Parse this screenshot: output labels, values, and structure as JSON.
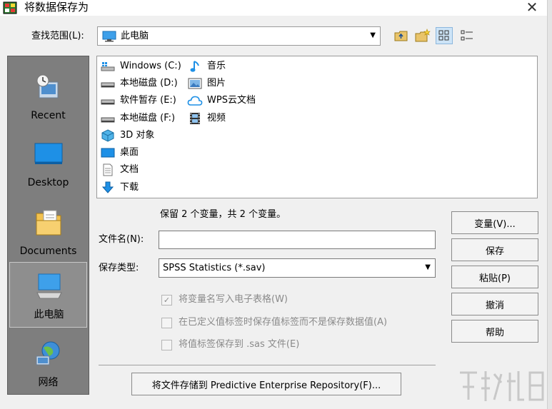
{
  "window": {
    "title": "将数据保存为",
    "close_glyph": "✕"
  },
  "lookin": {
    "label": "查找范围(L):",
    "value": "此电脑"
  },
  "places": [
    {
      "id": "recent",
      "label": "Recent"
    },
    {
      "id": "desktop",
      "label": "Desktop"
    },
    {
      "id": "documents",
      "label": "Documents"
    },
    {
      "id": "thispc",
      "label": "此电脑"
    },
    {
      "id": "network",
      "label": "网络"
    }
  ],
  "files": {
    "drive_c": "Windows (C:)",
    "drive_d": "本地磁盘 (D:)",
    "drive_e": "软件暂存 (E:)",
    "drive_f": "本地磁盘 (F:)",
    "objects3d": "3D 对象",
    "desktop": "桌面",
    "documents": "文档",
    "downloads": "下载",
    "music": "音乐",
    "pictures": "图片",
    "wps": "WPS云文档",
    "videos": "视频"
  },
  "form": {
    "retain_text": "保留 2 个变量，共 2 个变量。",
    "filename_label": "文件名(N):",
    "filename_value": "",
    "savetype_label": "保存类型:",
    "savetype_value": "SPSS Statistics (*.sav)",
    "options": [
      {
        "label": "将变量名写入电子表格(W)",
        "checked": true
      },
      {
        "label": "在已定义值标签时保存值标签而不是保存数据值(A)",
        "checked": false
      },
      {
        "label": "将值标签保存到 .sas 文件(E)",
        "checked": false
      }
    ],
    "checkmark": "✓"
  },
  "buttons": {
    "variables": "变量(V)...",
    "save": "保存",
    "paste": "粘贴(P)",
    "cancel": "撤消",
    "help": "帮助",
    "repository": "将文件存储到 Predictive Enterprise Repository(F)..."
  },
  "colors": {
    "accent_blue": "#1e90e6",
    "places_bg": "#7e7e7e",
    "selected_tool": "#cde4f7"
  }
}
